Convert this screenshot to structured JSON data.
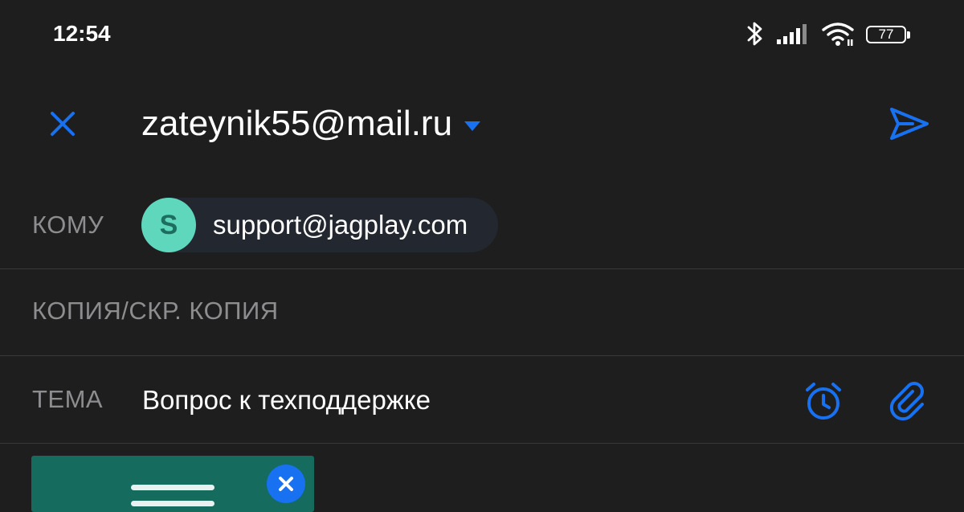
{
  "status_bar": {
    "time": "12:54",
    "battery": "77",
    "icons": [
      "bluetooth-icon",
      "signal-icon",
      "wifi-icon",
      "battery-icon"
    ]
  },
  "toolbar": {
    "from_email": "zateynik55@mail.ru",
    "close_icon": "close-icon",
    "send_icon": "send-icon"
  },
  "fields": {
    "to_label": "КОМУ",
    "recipient_initial": "S",
    "recipient_email": "support@jagplay.com",
    "cc_label": "КОПИЯ/СКР. КОПИЯ",
    "subject_label": "ТЕМА",
    "subject_value": "Вопрос к техподдержке"
  },
  "attachment": {
    "icon": "document-icon",
    "remove_icon": "close-icon"
  },
  "colors": {
    "background": "#1e1e1f",
    "accent": "#1771f1",
    "label": "#8d8d90",
    "avatar": "#5fd7bd",
    "attachment": "#146b5e"
  }
}
